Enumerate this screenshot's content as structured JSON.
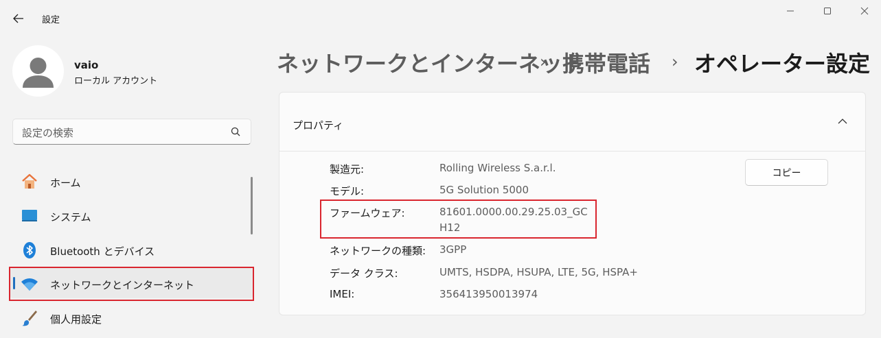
{
  "window": {
    "title": "設定",
    "controls": [
      "minimize-icon",
      "maximize-icon",
      "close-icon"
    ]
  },
  "user": {
    "name": "vaio",
    "account_type": "ローカル アカウント"
  },
  "search": {
    "placeholder": "設定の検索"
  },
  "nav": {
    "items": [
      {
        "label": "ホーム",
        "icon": "home-icon"
      },
      {
        "label": "システム",
        "icon": "system-icon"
      },
      {
        "label": "Bluetooth とデバイス",
        "icon": "bluetooth-icon"
      },
      {
        "label": "ネットワークとインターネット",
        "icon": "wifi-icon",
        "selected": true
      },
      {
        "label": "個人用設定",
        "icon": "brush-icon"
      }
    ]
  },
  "breadcrumb": {
    "items": [
      "ネットワークとインターネット",
      "携帯電話",
      "オペレーター設定"
    ],
    "separator": "›"
  },
  "properties": {
    "title": "プロパティ",
    "expanded": true,
    "copy_label": "コピー",
    "rows": [
      {
        "label": "製造元:",
        "value": "Rolling Wireless S.a.r.l."
      },
      {
        "label": "モデル:",
        "value": "5G Solution 5000"
      },
      {
        "label": "ファームウェア:",
        "value": "81601.0000.00.29.25.03_GC",
        "value_line2": "H12"
      },
      {
        "label": "ネットワークの種類:",
        "value": "3GPP"
      },
      {
        "label": "データ クラス:",
        "value": "UMTS, HSDPA, HSUPA, LTE, 5G, HSPA+"
      },
      {
        "label": "IMEI:",
        "value": "356413950013974"
      }
    ]
  },
  "colors": {
    "accent": "#1f6fbf",
    "highlight": "#d9252e"
  }
}
